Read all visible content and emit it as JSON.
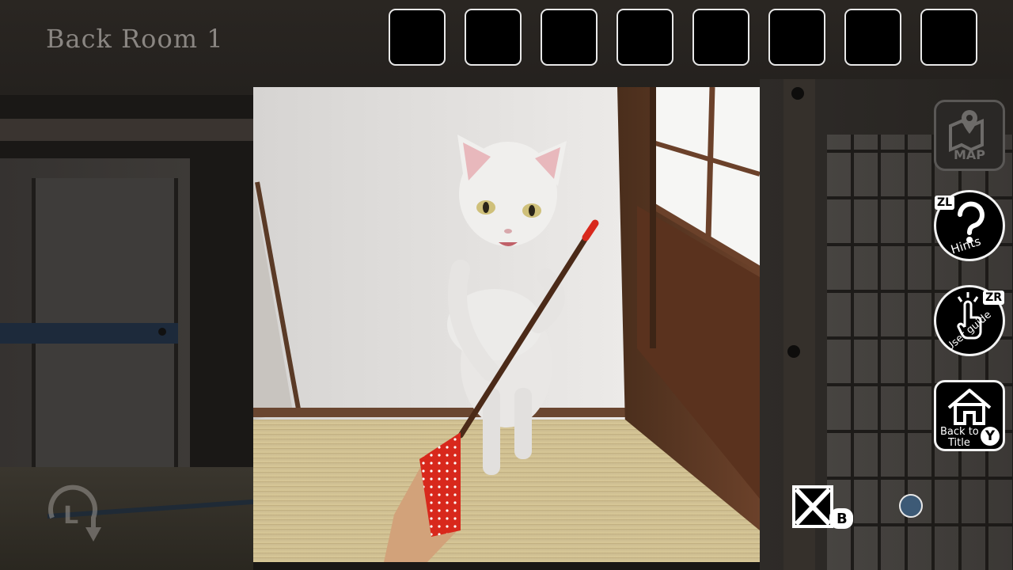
{
  "title": "Back Room 1",
  "inventory": {
    "slots": [
      "",
      "",
      "",
      "",
      "",
      "",
      "",
      ""
    ]
  },
  "menu": {
    "map": {
      "label": "MAP",
      "icon": "map-pin-icon"
    },
    "hints": {
      "label": "Hints",
      "badge": "ZL",
      "icon": "question-icon"
    },
    "user_guide": {
      "label": "User guide",
      "badge": "ZR",
      "icon": "tap-hand-icon"
    },
    "back_to_title": {
      "label_line1": "Back to",
      "label_line2": "Title",
      "badge": "Y",
      "icon": "house-icon"
    }
  },
  "controls": {
    "close": {
      "badge": "B",
      "icon": "close-box-icon"
    },
    "turn": {
      "badge": "L",
      "icon": "turn-arrow-icon"
    }
  },
  "colors": {
    "slot_border": "#e8e8e8",
    "indicator": "#3d5a76",
    "map_disabled": "#5a5856"
  }
}
